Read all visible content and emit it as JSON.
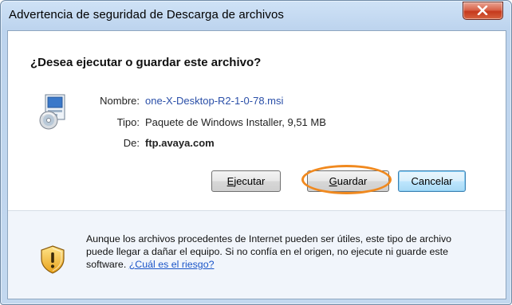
{
  "window": {
    "title": "Advertencia de seguridad de Descarga de archivos"
  },
  "dialog": {
    "question": "¿Desea ejecutar o guardar este archivo?",
    "file_icon": "installer-package-icon",
    "details": {
      "name_label": "Nombre:",
      "name_value": "one-X-Desktop-R2-1-0-78.msi",
      "type_label": "Tipo:",
      "type_value": "Paquete de Windows Installer, 9,51 MB",
      "from_label": "De:",
      "from_value": "ftp.avaya.com"
    },
    "buttons": {
      "run_accel": "E",
      "run_rest": "jecutar",
      "save_accel": "G",
      "save_rest": "uardar",
      "cancel_label": "Cancelar"
    },
    "highlight_color": "#f0891f"
  },
  "footer": {
    "shield_icon": "security-warning-shield-icon",
    "warning_text": "Aunque los archivos procedentes de Internet pueden ser útiles, este tipo de archivo puede llegar a dañar el equipo. Si no confía en el origen, no ejecute ni guarde este software.",
    "risk_link": "¿Cuál es el riesgo?"
  }
}
